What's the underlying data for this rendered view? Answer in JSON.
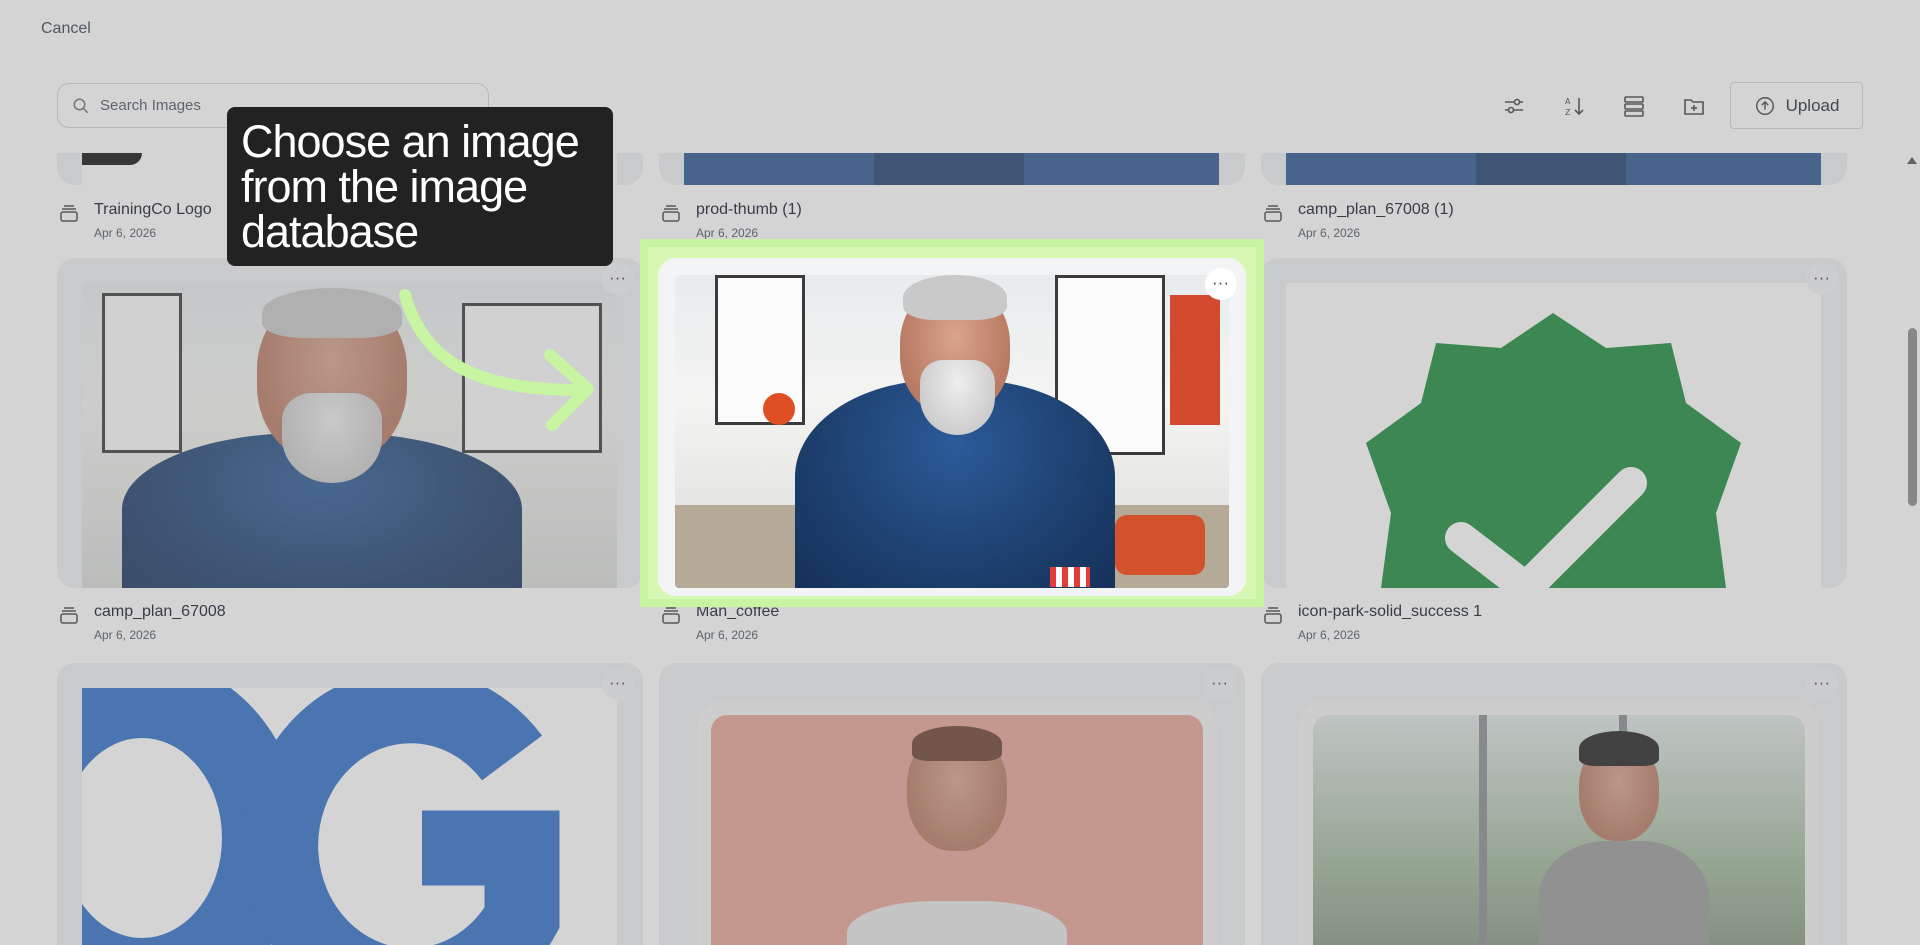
{
  "header": {
    "cancel_label": "Cancel",
    "search_placeholder": "Search Images",
    "upload_label": "Upload"
  },
  "toolbar": {
    "icons": [
      "filter-sliders-icon",
      "sort-az-icon",
      "list-view-icon",
      "new-folder-icon",
      "upload-icon"
    ]
  },
  "images": [
    {
      "name": "TrainingCo Logo",
      "date": "Apr 6, 2026"
    },
    {
      "name": "prod-thumb (1)",
      "date": "Apr 6, 2026"
    },
    {
      "name": "camp_plan_67008 (1)",
      "date": "Apr 6, 2026"
    },
    {
      "name": "camp_plan_67008",
      "date": "Apr 6, 2026"
    },
    {
      "name": "Man_coffee",
      "date": "Apr 6, 2026"
    },
    {
      "name": "icon-park-solid_success 1",
      "date": "Apr 6, 2026"
    }
  ],
  "more_label": "···",
  "tooltip": {
    "text": "Choose an image from the image database"
  },
  "colors": {
    "highlight": "#c7f5a1",
    "tooltip_bg": "#222222",
    "success_green": "#1a8a3c",
    "logo_blue": "#2f6fca"
  }
}
